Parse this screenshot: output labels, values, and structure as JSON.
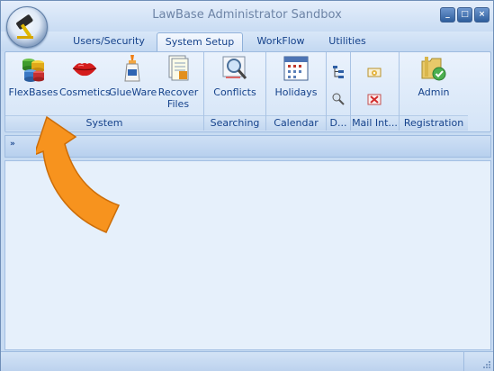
{
  "app": {
    "title": "LawBase Administrator Sandbox"
  },
  "window_controls": {
    "minimize": "_",
    "maximize": "□",
    "close": "×"
  },
  "tabs": [
    {
      "label": "Users/Security",
      "active": false
    },
    {
      "label": "System Setup",
      "active": true
    },
    {
      "label": "WorkFlow",
      "active": false
    },
    {
      "label": "Utilities",
      "active": false
    }
  ],
  "ribbon": {
    "groups": [
      {
        "label": "System",
        "buttons": [
          {
            "label": "FlexBases",
            "icon": "database-stack-icon"
          },
          {
            "label": "Cosmetics",
            "icon": "lips-icon"
          },
          {
            "label": "GlueWare",
            "icon": "glue-bottle-icon"
          },
          {
            "label": "Recover",
            "label2": "Files",
            "icon": "recover-files-icon"
          }
        ]
      },
      {
        "label": "Searching",
        "buttons": [
          {
            "label": "Conflicts",
            "icon": "magnifier-document-icon"
          }
        ]
      },
      {
        "label": "Calendar",
        "buttons": [
          {
            "label": "Holidays",
            "icon": "calendar-icon"
          }
        ]
      },
      {
        "label": "D...",
        "icons": [
          "tree-icon",
          "search-gear-icon"
        ]
      },
      {
        "label": "Mail Int...",
        "icons": [
          "mail-gear-icon",
          "mail-delete-icon"
        ]
      },
      {
        "label": "Registration",
        "buttons": [
          {
            "label": "Admin",
            "icon": "folder-check-icon"
          }
        ]
      }
    ]
  },
  "qat": {
    "chevron": "»"
  },
  "accent": {
    "arrow": "#f7931e",
    "ribbon_text": "#15428b"
  }
}
